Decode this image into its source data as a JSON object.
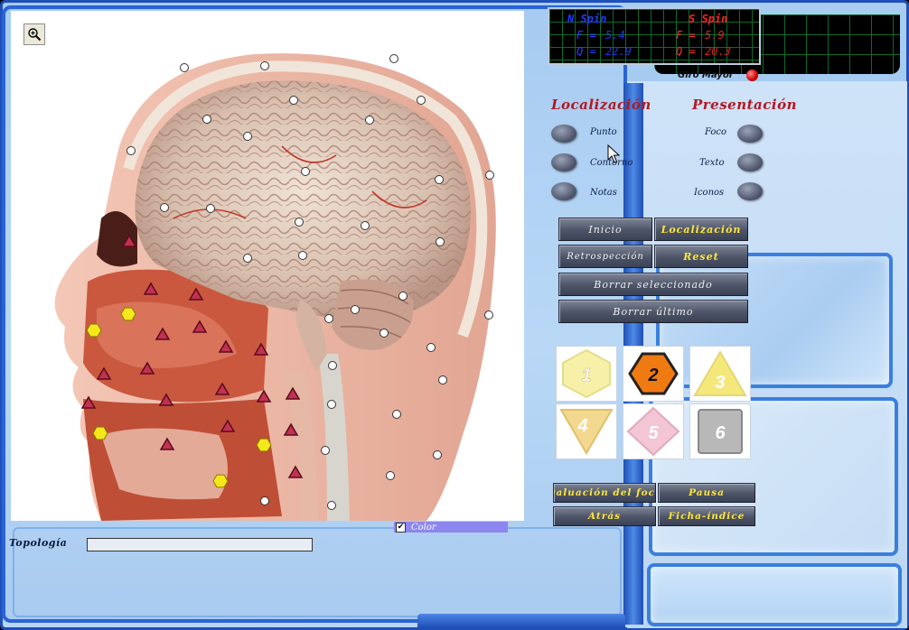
{
  "spin_display": {
    "north": {
      "title": "N  Spin",
      "f_label": "F =",
      "f_value": "5.4",
      "q_label": "Q =",
      "q_value": "22.9"
    },
    "south": {
      "title": "S  Spin",
      "f_label": "F =",
      "f_value": "5.9",
      "q_label": "Q =",
      "q_value": "20.3"
    },
    "giro_label": "Giro Mayor"
  },
  "localizacion": {
    "title": "Localización",
    "options": [
      "Punto",
      "Contorno",
      "Notas"
    ]
  },
  "presentacion": {
    "title": "Presentación",
    "options": [
      "Foco",
      "Texto",
      "Iconos"
    ]
  },
  "buttons": {
    "inicio": "Inicio",
    "localizacion": "Localización",
    "retrospeccion": "Retrospección",
    "reset": "Reset",
    "borrar_seleccionado": "Borrar seleccionado",
    "borrar_ultimo": "Borrar último",
    "evaluacion": "valuación del foc",
    "pausa": "Pausa",
    "atras": "Atrás",
    "ficha_indice": "Ficha-índice"
  },
  "tiles": [
    {
      "number": "1",
      "shape": "hexagon",
      "color": "#f6f0a8"
    },
    {
      "number": "2",
      "shape": "hexagon",
      "color": "#f07a12"
    },
    {
      "number": "3",
      "shape": "triangle-up",
      "color": "#f4e87a"
    },
    {
      "number": "4",
      "shape": "triangle-down",
      "color": "#f3d88f"
    },
    {
      "number": "5",
      "shape": "diamond",
      "color": "#f2c6d4"
    },
    {
      "number": "6",
      "shape": "square",
      "color": "#b8b8b8"
    }
  ],
  "viewer": {
    "zoom_icon": "magnifier-plus-icon",
    "markers": {
      "circle_color": "#ffffff",
      "triangle_color": "#c2314f",
      "hexagon_color": "#f5e81a"
    }
  },
  "color_toggle": {
    "label": "Color",
    "checked": true
  },
  "topologia": {
    "label": "Topología",
    "value": ""
  },
  "colors": {
    "accent_red": "#b01822",
    "button_yellow": "#ffe63a",
    "frame_blue": "#2a63d6"
  }
}
